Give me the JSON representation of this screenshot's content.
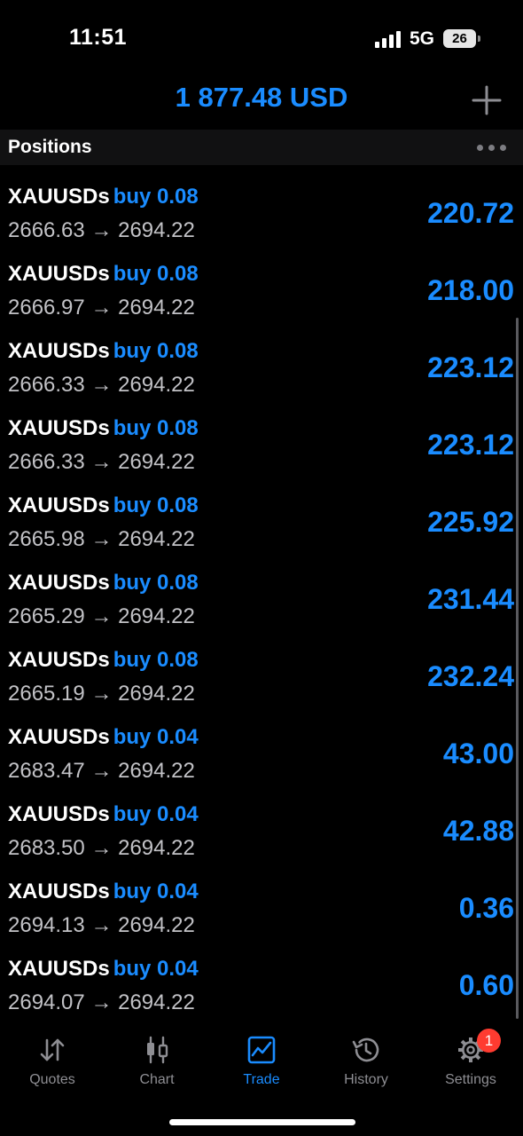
{
  "status_bar": {
    "time": "11:51",
    "network": "5G",
    "battery": "26"
  },
  "header": {
    "balance": "1 877.48 USD"
  },
  "section": {
    "title": "Positions"
  },
  "positions": [
    {
      "symbol": "XAUUSDs",
      "side": "buy 0.08",
      "open": "2666.63",
      "arrow": "→",
      "current": "2694.22",
      "profit": "220.72"
    },
    {
      "symbol": "XAUUSDs",
      "side": "buy 0.08",
      "open": "2666.97",
      "arrow": "→",
      "current": "2694.22",
      "profit": "218.00"
    },
    {
      "symbol": "XAUUSDs",
      "side": "buy 0.08",
      "open": "2666.33",
      "arrow": "→",
      "current": "2694.22",
      "profit": "223.12"
    },
    {
      "symbol": "XAUUSDs",
      "side": "buy 0.08",
      "open": "2666.33",
      "arrow": "→",
      "current": "2694.22",
      "profit": "223.12"
    },
    {
      "symbol": "XAUUSDs",
      "side": "buy 0.08",
      "open": "2665.98",
      "arrow": "→",
      "current": "2694.22",
      "profit": "225.92"
    },
    {
      "symbol": "XAUUSDs",
      "side": "buy 0.08",
      "open": "2665.29",
      "arrow": "→",
      "current": "2694.22",
      "profit": "231.44"
    },
    {
      "symbol": "XAUUSDs",
      "side": "buy 0.08",
      "open": "2665.19",
      "arrow": "→",
      "current": "2694.22",
      "profit": "232.24"
    },
    {
      "symbol": "XAUUSDs",
      "side": "buy 0.04",
      "open": "2683.47",
      "arrow": "→",
      "current": "2694.22",
      "profit": "43.00"
    },
    {
      "symbol": "XAUUSDs",
      "side": "buy 0.04",
      "open": "2683.50",
      "arrow": "→",
      "current": "2694.22",
      "profit": "42.88"
    },
    {
      "symbol": "XAUUSDs",
      "side": "buy 0.04",
      "open": "2694.13",
      "arrow": "→",
      "current": "2694.22",
      "profit": "0.36"
    },
    {
      "symbol": "XAUUSDs",
      "side": "buy 0.04",
      "open": "2694.07",
      "arrow": "→",
      "current": "2694.22",
      "profit": "0.60"
    }
  ],
  "tabs": [
    {
      "label": "Quotes",
      "icon": "quotes-icon"
    },
    {
      "label": "Chart",
      "icon": "chart-icon"
    },
    {
      "label": "Trade",
      "icon": "trade-icon",
      "active": true
    },
    {
      "label": "History",
      "icon": "history-icon"
    },
    {
      "label": "Settings",
      "icon": "gear-icon",
      "badge": "1"
    }
  ],
  "colors": {
    "accent": "#1a8cff",
    "background": "#000000",
    "secondary_text": "#c2c2c6",
    "inactive_tab": "#8e8e93",
    "badge": "#ff3b30"
  }
}
